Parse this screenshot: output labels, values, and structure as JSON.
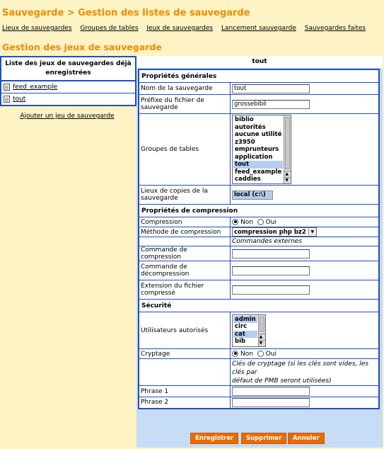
{
  "header": {
    "title": "Sauvegarde > Gestion des listes de sauvegarde"
  },
  "nav": {
    "items": [
      "Lieux de sauvegardes",
      "Groupes de tables",
      "Jeux de sauvegardes",
      "Lancement sauvegarde",
      "Sauvegardes faites"
    ]
  },
  "section": {
    "title": "Gestion des jeux de sauvegarde"
  },
  "left": {
    "header": "Liste des jeux de sauvegardes déjà enregistrées",
    "sets": [
      "feed_example",
      "tout"
    ],
    "add_link": "Ajouter un jeu de sauvegarde"
  },
  "right": {
    "header": "tout",
    "general": {
      "section": "Propriétés générales",
      "name_label": "Nom de la sauvegarde",
      "name_value": "tout",
      "prefix_label": "Préfixe du fichier de sauvegarde",
      "prefix_value": "grossebibli",
      "groups_label": "Groupes de tables",
      "groups_options": [
        "biblio",
        "autorités",
        "aucune utilité",
        "z3950",
        "emprunteurs",
        "application",
        "tout",
        "feed_example",
        "caddies"
      ],
      "groups_selected": "tout",
      "copies_label": "Lieux de copies de la sauvegarde",
      "copies_value": "local (c:\\)"
    },
    "compression": {
      "section": "Propriétés de compression",
      "compression_label": "Compression",
      "option_no": "Non",
      "option_yes": "Oui",
      "method_label": "Méthode de compression",
      "method_value": "compression php bz2",
      "external_label": "Commandes externes",
      "compress_cmd_label": "Commande de compression",
      "decompress_cmd_label": "Commande de décompression",
      "extension_label": "Extension du fichier compressé"
    },
    "security": {
      "section": "Sécurité",
      "users_label": "Utilisateurs autorisés",
      "users_options": [
        "admin",
        "circ",
        "cat",
        "bib"
      ],
      "users_selected": [
        "admin",
        "cat"
      ],
      "crypt_label": "Cryptage",
      "option_no": "Non",
      "option_yes": "Oui",
      "crypt_note_1": "Clés de cryptage (si les clés sont vides, les clés par",
      "crypt_note_2": "défaut de PMB seront utilisées)",
      "phrase1_label": "Phrase 1",
      "phrase2_label": "Phrase 2"
    },
    "buttons": {
      "save": "Enregistrer",
      "delete": "Supprimer",
      "cancel": "Annuler"
    }
  }
}
